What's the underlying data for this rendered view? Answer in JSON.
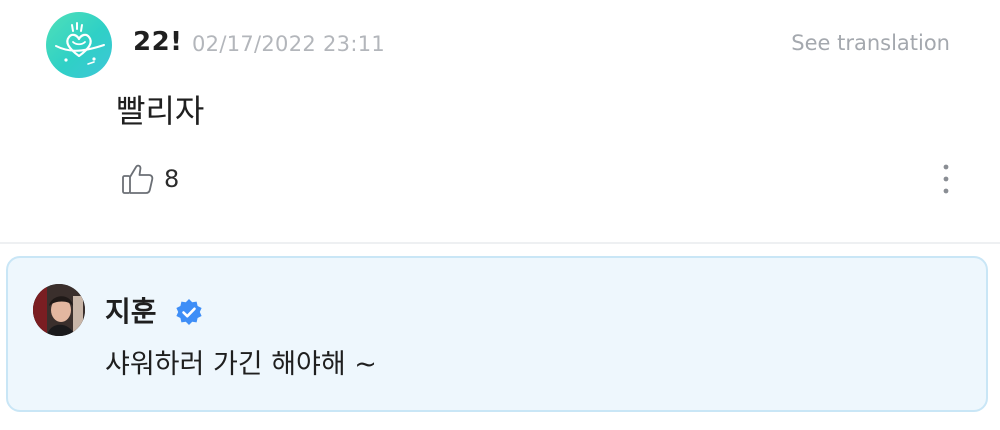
{
  "comment": {
    "author": "22!",
    "timestamp": "02/17/2022 23:11",
    "see_translation": "See translation",
    "text": "빨리자",
    "like_count": "8",
    "avatar_icon": "heart-doodle-avatar-icon",
    "like_icon": "thumbs-up-icon",
    "more_icon": "more-vertical-icon"
  },
  "reply": {
    "author": "지훈",
    "verified_icon": "verified-badge-icon",
    "text": "샤워하러 가긴 해야해 ~",
    "avatar_icon": "profile-photo-avatar"
  },
  "colors": {
    "avatar_gradient_start": "#4fe0b8",
    "avatar_gradient_end": "#3fc6d8",
    "verified_blue": "#3e8ef7",
    "reply_background": "#eef7fd",
    "reply_border": "#c9e6f6",
    "muted_text": "#b3b6bb"
  }
}
